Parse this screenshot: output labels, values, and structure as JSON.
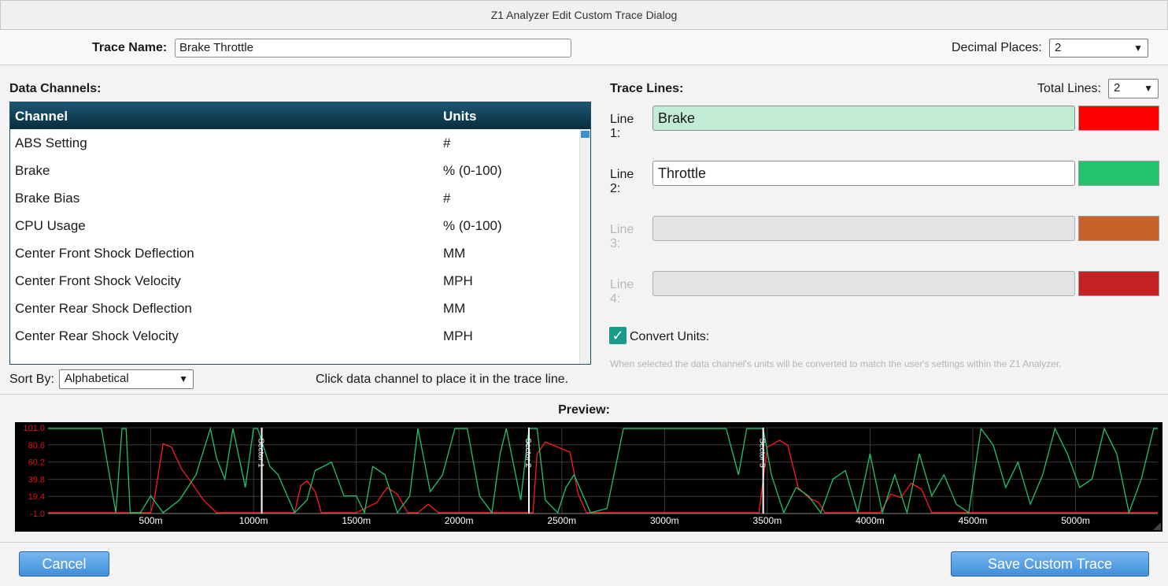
{
  "window": {
    "title": "Z1 Analyzer Edit Custom Trace Dialog"
  },
  "trace": {
    "name_label": "Trace Name:",
    "name_value": "Brake Throttle",
    "decimal_label": "Decimal Places:",
    "decimal_value": "2"
  },
  "channels": {
    "label": "Data Channels:",
    "col_channel": "Channel",
    "col_units": "Units",
    "rows": [
      {
        "name": "ABS Setting",
        "units": "#"
      },
      {
        "name": "Brake",
        "units": "% (0-100)"
      },
      {
        "name": "Brake Bias",
        "units": "#"
      },
      {
        "name": "CPU Usage",
        "units": "% (0-100)"
      },
      {
        "name": "Center Front Shock Deflection",
        "units": "MM"
      },
      {
        "name": "Center Front Shock Velocity",
        "units": "MPH"
      },
      {
        "name": "Center Rear Shock Deflection",
        "units": "MM"
      },
      {
        "name": "Center Rear Shock Velocity",
        "units": "MPH"
      }
    ],
    "sort_label": "Sort By:",
    "sort_value": "Alphabetical",
    "hint": "Click data channel to place it in the trace line."
  },
  "lines": {
    "label": "Trace Lines:",
    "total_label": "Total Lines:",
    "total_value": "2",
    "items": [
      {
        "label": "Line 1:",
        "value": "Brake",
        "color": "#ff0000",
        "state": "active"
      },
      {
        "label": "Line 2:",
        "value": "Throttle",
        "color": "#22c36a",
        "state": "enabled"
      },
      {
        "label": "Line 3:",
        "value": "",
        "color": "#c8622a",
        "state": "disabled"
      },
      {
        "label": "Line 4:",
        "value": "",
        "color": "#c42222",
        "state": "disabled"
      }
    ],
    "convert_label": "Convert Units:",
    "convert_checked": true,
    "convert_note": "When selected the data channel's units will be converted to match the user's settings within the Z1 Analyzer."
  },
  "preview": {
    "label": "Preview:",
    "chart_data": {
      "type": "line",
      "y_ticks": [
        "101.0",
        "80.6",
        "60.2",
        "39.8",
        "19.4",
        "-1.0"
      ],
      "ylim": [
        -1.0,
        101.0
      ],
      "x_ticks": [
        "500m",
        "1000m",
        "1500m",
        "2000m",
        "2500m",
        "3000m",
        "3500m",
        "4000m",
        "4500m",
        "5000m"
      ],
      "xlim": [
        0,
        5400
      ],
      "sectors": [
        {
          "label": "Sector 1",
          "x": 1040
        },
        {
          "label": "Sector 2",
          "x": 2340
        },
        {
          "label": "Sector 3",
          "x": 3480
        }
      ],
      "series": [
        {
          "color": "#ff1a1a",
          "x": [
            0,
            500,
            520,
            560,
            600,
            650,
            700,
            760,
            820,
            880,
            950,
            1000,
            1050,
            1100,
            1150,
            1200,
            1230,
            1260,
            1300,
            1330,
            1400,
            1500,
            1600,
            1650,
            1700,
            1750,
            1800,
            1850,
            1900,
            2000,
            2100,
            2200,
            2250,
            2300,
            2360,
            2380,
            2420,
            2480,
            2540,
            2580,
            2620,
            2700,
            2800,
            2900,
            3000,
            3100,
            3200,
            3300,
            3400,
            3460,
            3500,
            3560,
            3600,
            3650,
            3700,
            3750,
            3780,
            3820,
            3860,
            3900,
            3950,
            4000,
            4050,
            4100,
            4150,
            4200,
            4250,
            4300,
            4350,
            4400,
            4450,
            4500,
            4550,
            4600,
            4650,
            4700,
            4750,
            4800,
            4850,
            4900,
            4950,
            5000,
            5050,
            5100,
            5150,
            5200,
            5250,
            5300,
            5350,
            5400
          ],
          "y": [
            0,
            0,
            20,
            82,
            78,
            52,
            35,
            14,
            0,
            0,
            0,
            0,
            0,
            0,
            0,
            0,
            32,
            38,
            25,
            0,
            0,
            0,
            12,
            30,
            22,
            0,
            0,
            10,
            0,
            0,
            0,
            0,
            0,
            0,
            0,
            70,
            84,
            78,
            72,
            22,
            0,
            0,
            0,
            0,
            0,
            0,
            0,
            0,
            0,
            0,
            78,
            86,
            80,
            30,
            18,
            12,
            0,
            0,
            0,
            0,
            0,
            0,
            0,
            22,
            18,
            35,
            28,
            0,
            0,
            0,
            0,
            0,
            0,
            0,
            0,
            0,
            0,
            0,
            0,
            0,
            0,
            0,
            0,
            0,
            0,
            0,
            0,
            0,
            0,
            0
          ]
        },
        {
          "color": "#22c36a",
          "x": [
            0,
            180,
            220,
            260,
            330,
            360,
            380,
            400,
            450,
            500,
            560,
            640,
            720,
            790,
            820,
            860,
            900,
            960,
            1000,
            1020,
            1080,
            1120,
            1200,
            1260,
            1300,
            1380,
            1440,
            1500,
            1540,
            1580,
            1640,
            1700,
            1760,
            1800,
            1860,
            1920,
            1980,
            2040,
            2100,
            2160,
            2200,
            2230,
            2300,
            2340,
            2380,
            2420,
            2480,
            2520,
            2560,
            2640,
            2720,
            2800,
            2880,
            2940,
            3000,
            3060,
            3100,
            3160,
            3220,
            3300,
            3360,
            3400,
            3440,
            3480,
            3520,
            3580,
            3640,
            3700,
            3760,
            3820,
            3880,
            3940,
            4000,
            4060,
            4120,
            4180,
            4240,
            4300,
            4360,
            4420,
            4480,
            4540,
            4600,
            4660,
            4720,
            4780,
            4840,
            4900,
            4960,
            5020,
            5080,
            5140,
            5200,
            5260,
            5320,
            5380,
            5400
          ],
          "y": [
            100,
            100,
            100,
            100,
            0,
            100,
            100,
            0,
            0,
            20,
            0,
            15,
            45,
            100,
            65,
            40,
            100,
            30,
            100,
            100,
            55,
            45,
            0,
            15,
            50,
            60,
            20,
            20,
            0,
            55,
            45,
            0,
            20,
            100,
            25,
            45,
            100,
            100,
            20,
            0,
            70,
            100,
            15,
            100,
            100,
            15,
            0,
            30,
            45,
            0,
            5,
            100,
            100,
            100,
            100,
            100,
            100,
            100,
            100,
            100,
            45,
            100,
            100,
            100,
            45,
            0,
            30,
            20,
            0,
            40,
            50,
            0,
            70,
            0,
            45,
            0,
            70,
            20,
            45,
            10,
            0,
            100,
            80,
            30,
            60,
            10,
            45,
            100,
            70,
            30,
            40,
            100,
            70,
            0,
            40,
            100,
            100
          ]
        }
      ]
    }
  },
  "buttons": {
    "cancel": "Cancel",
    "save": "Save Custom Trace"
  }
}
